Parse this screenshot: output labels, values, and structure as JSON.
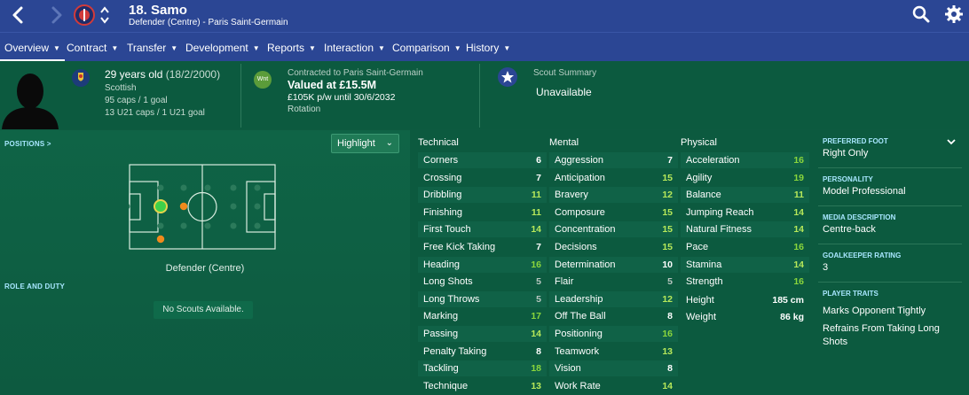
{
  "header": {
    "player_name": "18. Samo",
    "player_subtitle": "Defender (Centre) - Paris Saint-Germain",
    "back_icon": "chevron-left-icon",
    "forward_icon": "chevron-right-icon",
    "club_badge": "psg-badge-icon",
    "search_icon": "search-icon",
    "settings_icon": "gear-icon",
    "bg_color": "#2b4694"
  },
  "tabs": [
    {
      "label": "Overview"
    },
    {
      "label": "Contract"
    },
    {
      "label": "Transfer"
    },
    {
      "label": "Development"
    },
    {
      "label": "Reports"
    },
    {
      "label": "Interaction"
    },
    {
      "label": "Comparison"
    },
    {
      "label": "History"
    }
  ],
  "info": {
    "age": "29 years old",
    "dob": "(18/2/2000)",
    "nationality": "Scottish",
    "caps": "95 caps / 1 goal",
    "u21_caps": "13 U21 caps / 1 U21 goal",
    "contract_badge": "Wnt",
    "contract_label": "Contracted to Paris Saint-Germain",
    "value": "Valued at £15.5M",
    "wage": "£105K p/w until 30/6/2032",
    "squad_status": "Rotation",
    "scout_label": "Scout Summary",
    "scout_value": "Unavailable"
  },
  "left": {
    "positions_title": "POSITIONS >",
    "highlight_label": "Highlight",
    "position_caption": "Defender (Centre)",
    "role_title": "ROLE AND DUTY",
    "no_scouts": "No Scouts Available."
  },
  "attributes": {
    "technical_title": "Technical",
    "mental_title": "Mental",
    "physical_title": "Physical",
    "technical": [
      {
        "name": "Corners",
        "value": "6"
      },
      {
        "name": "Crossing",
        "value": "7"
      },
      {
        "name": "Dribbling",
        "value": "11"
      },
      {
        "name": "Finishing",
        "value": "11"
      },
      {
        "name": "First Touch",
        "value": "14"
      },
      {
        "name": "Free Kick Taking",
        "value": "7"
      },
      {
        "name": "Heading",
        "value": "16"
      },
      {
        "name": "Long Shots",
        "value": "5"
      },
      {
        "name": "Long Throws",
        "value": "5"
      },
      {
        "name": "Marking",
        "value": "17"
      },
      {
        "name": "Passing",
        "value": "14"
      },
      {
        "name": "Penalty Taking",
        "value": "8"
      },
      {
        "name": "Tackling",
        "value": "18"
      },
      {
        "name": "Technique",
        "value": "13"
      }
    ],
    "mental": [
      {
        "name": "Aggression",
        "value": "7"
      },
      {
        "name": "Anticipation",
        "value": "15"
      },
      {
        "name": "Bravery",
        "value": "12"
      },
      {
        "name": "Composure",
        "value": "15"
      },
      {
        "name": "Concentration",
        "value": "15"
      },
      {
        "name": "Decisions",
        "value": "15"
      },
      {
        "name": "Determination",
        "value": "10"
      },
      {
        "name": "Flair",
        "value": "5"
      },
      {
        "name": "Leadership",
        "value": "12"
      },
      {
        "name": "Off The Ball",
        "value": "8"
      },
      {
        "name": "Positioning",
        "value": "16"
      },
      {
        "name": "Teamwork",
        "value": "13"
      },
      {
        "name": "Vision",
        "value": "8"
      },
      {
        "name": "Work Rate",
        "value": "14"
      }
    ],
    "physical": [
      {
        "name": "Acceleration",
        "value": "16"
      },
      {
        "name": "Agility",
        "value": "19"
      },
      {
        "name": "Balance",
        "value": "11"
      },
      {
        "name": "Jumping Reach",
        "value": "14"
      },
      {
        "name": "Natural Fitness",
        "value": "14"
      },
      {
        "name": "Pace",
        "value": "16"
      },
      {
        "name": "Stamina",
        "value": "14"
      },
      {
        "name": "Strength",
        "value": "16"
      }
    ],
    "height_label": "Height",
    "height_value": "185 cm",
    "weight_label": "Weight",
    "weight_value": "86 kg"
  },
  "right": {
    "preferred_foot_label": "PREFERRED FOOT",
    "preferred_foot": "Right Only",
    "personality_label": "PERSONALITY",
    "personality": "Model Professional",
    "media_label": "MEDIA DESCRIPTION",
    "media": "Centre-back",
    "gk_label": "GOALKEEPER RATING",
    "gk_rating": "3",
    "traits_label": "PLAYER TRAITS",
    "trait_1": "Marks Opponent Tightly",
    "trait_2_line1": "Refrains From Taking Long",
    "trait_2_line2": "Shots"
  }
}
